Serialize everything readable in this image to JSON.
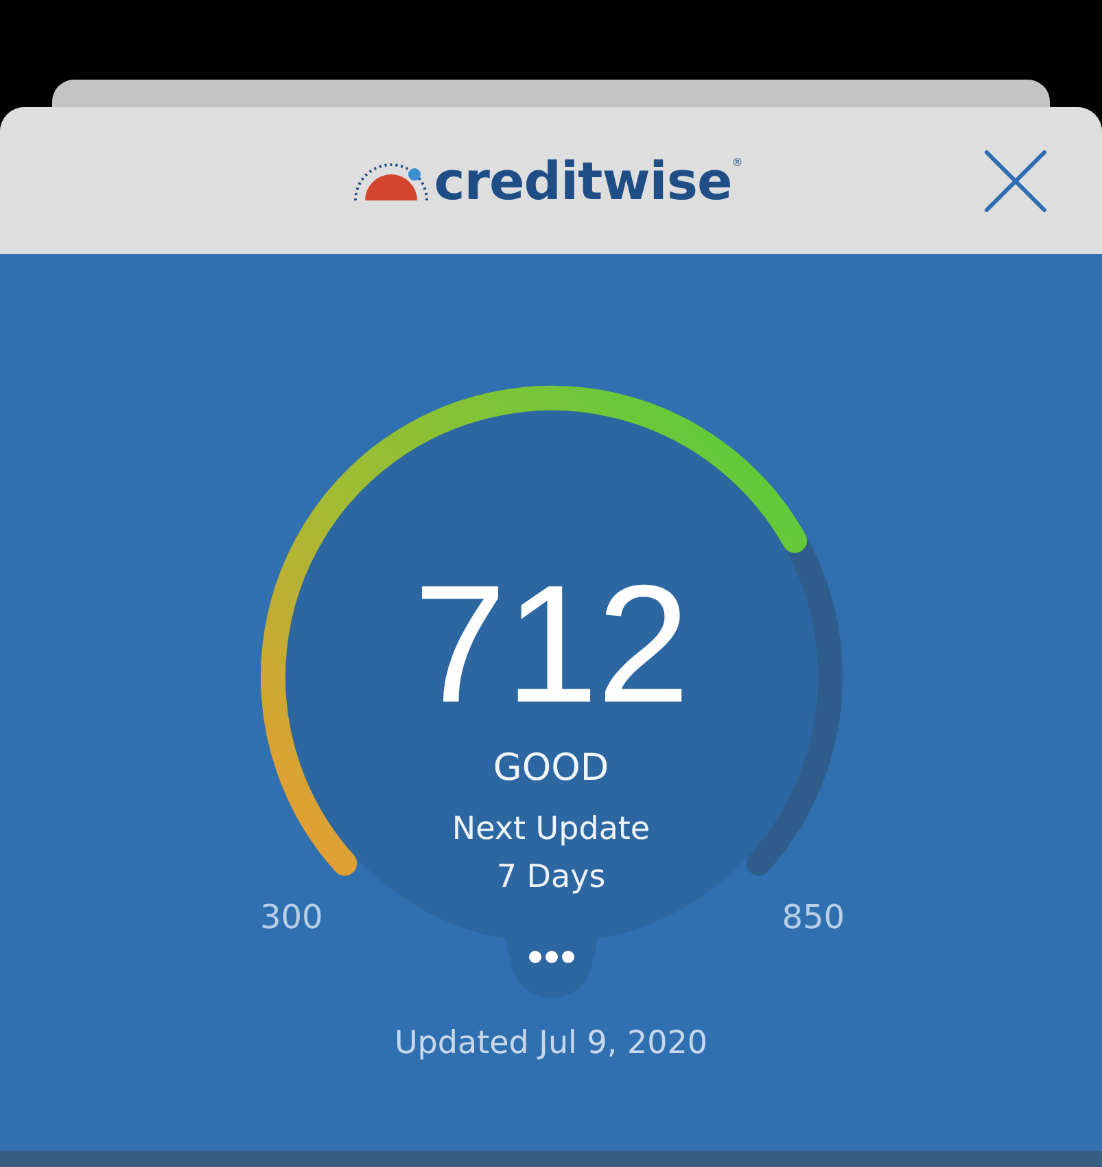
{
  "header": {
    "logo": "creditwise$^{®}$"
  },
  "score": {
    "value": "712",
    "rating": "GOOD",
    "next_update_label": "Next Update",
    "next_update_value": "7 Days",
    "min": "300",
    "max": "850"
  },
  "updated": "Updated Jul 9, 2020"
}
